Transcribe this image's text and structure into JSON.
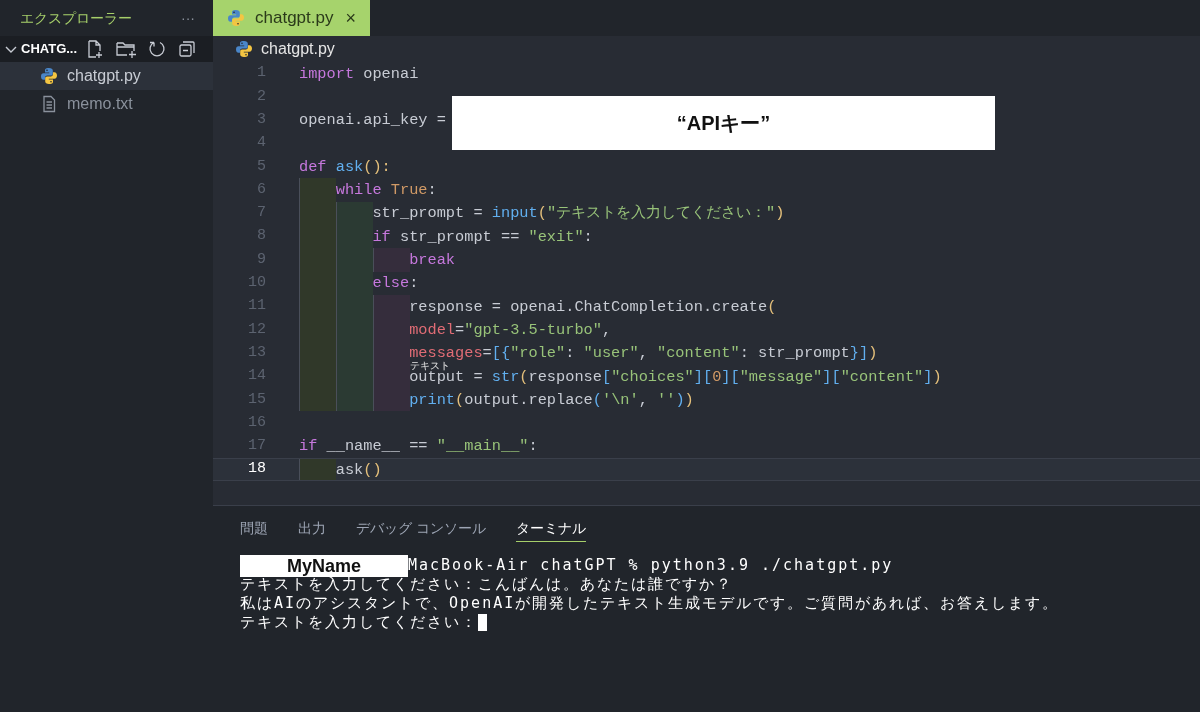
{
  "sidebar": {
    "title": "エクスプローラー",
    "more": "···",
    "folder": {
      "name": "CHATG...",
      "expanded": true
    },
    "files": [
      {
        "name": "chatgpt.py",
        "kind": "python",
        "selected": true
      },
      {
        "name": "memo.txt",
        "kind": "text",
        "selected": false
      }
    ]
  },
  "editor_tabs": [
    {
      "label": "chatgpt.py",
      "kind": "python",
      "selected": true,
      "close": "×"
    }
  ],
  "breadcrumb": {
    "label": "chatgpt.py",
    "kind": "python"
  },
  "code_lines": [
    {
      "number": "1",
      "current": false,
      "tokens": [
        {
          "text": "import",
          "kind": "keyword"
        },
        {
          "text": " openai",
          "kind": "plain"
        }
      ]
    },
    {
      "number": "2",
      "current": false
    },
    {
      "number": "3",
      "current": false,
      "tokens": [
        {
          "text": "openai.api_key = ",
          "kind": "plain"
        }
      ]
    },
    {
      "number": "4",
      "current": false
    },
    {
      "number": "5",
      "current": false,
      "tokens": [
        {
          "text": "def ",
          "kind": "keyword"
        },
        {
          "text": "ask",
          "kind": "function"
        },
        {
          "text": "():",
          "kind": "paren"
        }
      ]
    },
    {
      "number": "6",
      "current": false,
      "tokens": [
        {
          "text": "    while ",
          "kind": "keyword"
        },
        {
          "text": "True",
          "kind": "constant"
        },
        {
          "text": ":",
          "kind": "plain"
        }
      ]
    },
    {
      "number": "7",
      "current": false,
      "tokens": [
        {
          "text": "        str_prompt = ",
          "kind": "plain"
        },
        {
          "text": "input",
          "kind": "function"
        },
        {
          "text": "(",
          "kind": "paren"
        },
        {
          "text": "\"テキストを入力してください：\"",
          "kind": "string"
        },
        {
          "text": ")",
          "kind": "paren"
        }
      ]
    },
    {
      "number": "8",
      "current": false,
      "tokens": [
        {
          "text": "        if",
          "kind": "keyword"
        },
        {
          "text": " str_prompt == ",
          "kind": "plain"
        },
        {
          "text": "\"exit\"",
          "kind": "string"
        },
        {
          "text": ":",
          "kind": "plain"
        }
      ]
    },
    {
      "number": "9",
      "current": false,
      "tokens": [
        {
          "text": "            break",
          "kind": "keyword"
        }
      ]
    },
    {
      "number": "10",
      "current": false,
      "tokens": [
        {
          "text": "        else",
          "kind": "keyword"
        },
        {
          "text": ":",
          "kind": "plain"
        }
      ]
    },
    {
      "number": "11",
      "current": false,
      "tokens": [
        {
          "text": "            response = openai.ChatCompletion.create",
          "kind": "plain"
        },
        {
          "text": "(",
          "kind": "paren"
        }
      ]
    },
    {
      "number": "12",
      "current": false,
      "tokens": [
        {
          "text": "            model",
          "kind": "param"
        },
        {
          "text": "=",
          "kind": "plain"
        },
        {
          "text": "\"gpt-3.5-turbo\"",
          "kind": "string"
        },
        {
          "text": ",",
          "kind": "plain"
        }
      ]
    },
    {
      "number": "13",
      "current": false,
      "tokens": [
        {
          "text": "            messages",
          "kind": "param"
        },
        {
          "text": "=",
          "kind": "plain"
        },
        {
          "text": "[{",
          "kind": "bracket"
        },
        {
          "text": "\"role\"",
          "kind": "string"
        },
        {
          "text": ": ",
          "kind": "plain"
        },
        {
          "text": "\"user\"",
          "kind": "string"
        },
        {
          "text": ", ",
          "kind": "plain"
        },
        {
          "text": "\"content\"",
          "kind": "string"
        },
        {
          "text": ": str_prompt",
          "kind": "plain"
        },
        {
          "text": "}]",
          "kind": "bracket"
        },
        {
          "text": ")",
          "kind": "paren"
        }
      ]
    },
    {
      "number": "14",
      "current": false,
      "tokens": [
        {
          "text": "            output = ",
          "kind": "plain"
        },
        {
          "text": "str",
          "kind": "function"
        },
        {
          "text": "(",
          "kind": "paren"
        },
        {
          "text": "response",
          "kind": "plain"
        },
        {
          "text": "[",
          "kind": "bracket"
        },
        {
          "text": "\"choices\"",
          "kind": "string"
        },
        {
          "text": "][",
          "kind": "bracket"
        },
        {
          "text": "0",
          "kind": "constant"
        },
        {
          "text": "][",
          "kind": "bracket"
        },
        {
          "text": "\"message\"",
          "kind": "string"
        },
        {
          "text": "][",
          "kind": "bracket"
        },
        {
          "text": "\"content\"",
          "kind": "string"
        },
        {
          "text": "]",
          "kind": "bracket"
        },
        {
          "text": ")",
          "kind": "paren"
        }
      ]
    },
    {
      "number": "15",
      "current": false,
      "tokens": [
        {
          "text": "            print",
          "kind": "function"
        },
        {
          "text": "(",
          "kind": "paren"
        },
        {
          "text": "output.replace",
          "kind": "plain"
        },
        {
          "text": "(",
          "kind": "bracket"
        },
        {
          "text": "'\\n'",
          "kind": "string"
        },
        {
          "text": ", ",
          "kind": "plain"
        },
        {
          "text": "''",
          "kind": "string"
        },
        {
          "text": ")",
          "kind": "bracket"
        },
        {
          "text": ")",
          "kind": "paren"
        }
      ]
    },
    {
      "number": "16",
      "current": false
    },
    {
      "number": "17",
      "current": false,
      "tokens": [
        {
          "text": "if",
          "kind": "keyword"
        },
        {
          "text": " __name__ == ",
          "kind": "plain"
        },
        {
          "text": "\"__main__\"",
          "kind": "string"
        },
        {
          "text": ":",
          "kind": "plain"
        }
      ]
    },
    {
      "number": "18",
      "current": true,
      "tokens": [
        {
          "text": "    ask",
          "kind": "plain"
        },
        {
          "text": "()",
          "kind": "paren"
        }
      ]
    }
  ],
  "api_key_box": "“APIキー”",
  "annotation": "テキスト",
  "panel_tabs": [
    {
      "label": "問題",
      "selected": false
    },
    {
      "label": "出力",
      "selected": false
    },
    {
      "label": "デバッグ コンソール",
      "selected": false
    },
    {
      "label": "ターミナル",
      "selected": true
    }
  ],
  "terminal": {
    "user_box": "MyName",
    "lines": [
      {
        "text": "MacBook-Air chatGPT % python3.9 ./chatgpt.py",
        "kind": "prompt",
        "cursor": false
      },
      {
        "text": "テキストを入力してください：こんばんは。あなたは誰ですか？",
        "kind": "output",
        "cursor": false
      },
      {
        "text": "私はAIのアシスタントで、OpenAIが開発したテキスト生成モデルです。ご質問があれば、お答えします。",
        "kind": "output",
        "cursor": false
      },
      {
        "text": "テキストを入力してください：",
        "kind": "output",
        "cursor": true
      }
    ]
  }
}
